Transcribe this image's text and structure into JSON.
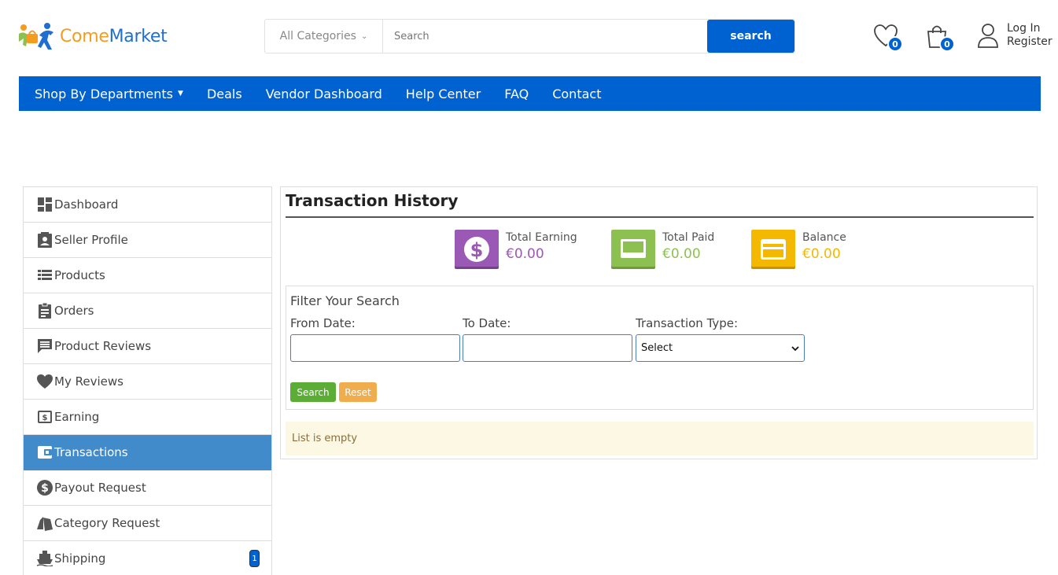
{
  "header": {
    "logo": {
      "part1": "Come",
      "part2": "Market"
    },
    "search": {
      "category": "All Categories",
      "placeholder": "Search",
      "button": "search"
    },
    "wishlist_count": "0",
    "cart_count": "0",
    "account": {
      "login": "Log In",
      "register": "Register"
    }
  },
  "nav": {
    "items": [
      "Shop By Departments",
      "Deals",
      "Vendor Dashboard",
      "Help Center",
      "FAQ",
      "Contact"
    ]
  },
  "sidebar": {
    "items": [
      {
        "label": "Dashboard",
        "icon": "dashboard-icon"
      },
      {
        "label": "Seller Profile",
        "icon": "profile-card-icon"
      },
      {
        "label": "Products",
        "icon": "list-icon"
      },
      {
        "label": "Orders",
        "icon": "clipboard-icon"
      },
      {
        "label": "Product Reviews",
        "icon": "comment-icon"
      },
      {
        "label": "My Reviews",
        "icon": "heart-icon"
      },
      {
        "label": "Earning",
        "icon": "money-icon"
      },
      {
        "label": "Transactions",
        "icon": "wallet-icon",
        "active": true
      },
      {
        "label": "Payout Request",
        "icon": "dollar-circle-icon"
      },
      {
        "label": "Category Request",
        "icon": "tags-icon"
      },
      {
        "label": "Shipping",
        "icon": "ship-icon",
        "badge": "1"
      }
    ]
  },
  "main": {
    "title": "Transaction History",
    "stats": [
      {
        "label": "Total Earning",
        "value": "€0.00",
        "color": "#9b59b6"
      },
      {
        "label": "Total Paid",
        "value": "€0.00",
        "color": "#8cc152"
      },
      {
        "label": "Balance",
        "value": "€0.00",
        "color": "#f5b800"
      }
    ],
    "filter": {
      "title": "Filter Your Search",
      "from_label": "From Date:",
      "to_label": "To Date:",
      "type_label": "Transaction Type:",
      "type_value": "Select",
      "search_button": "Search",
      "reset_button": "Reset"
    },
    "empty_message": "List is empty"
  },
  "colors": {
    "brand_blue": "#0062d1",
    "active_blue": "#428bca",
    "logo_orange": "#f39c1f"
  }
}
